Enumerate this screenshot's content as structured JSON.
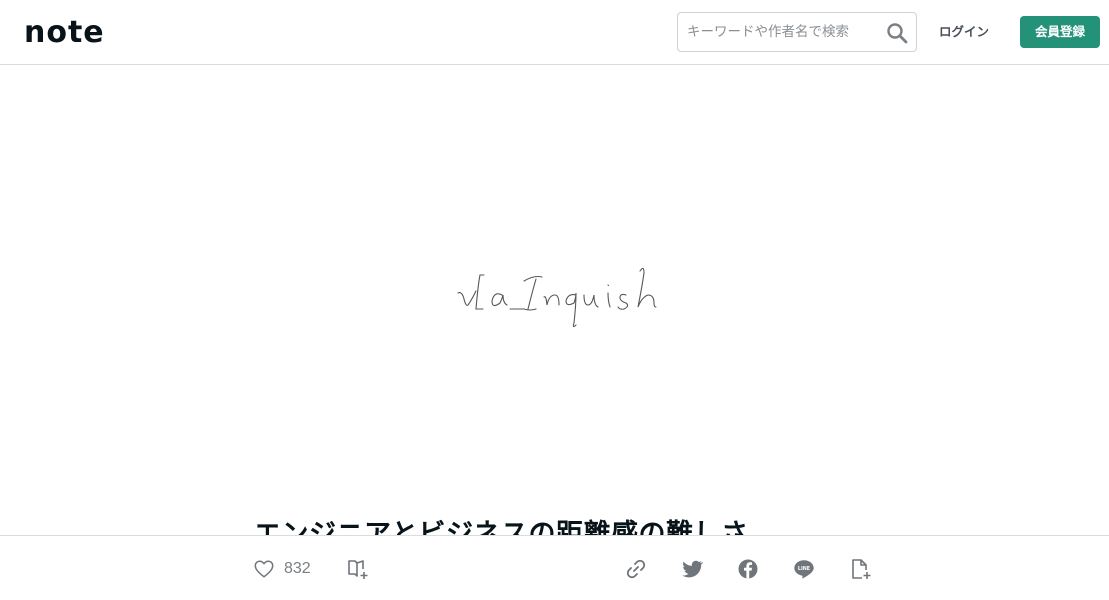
{
  "header": {
    "logo_text": "note",
    "search": {
      "placeholder": "キーワードや作者名で検索",
      "value": ""
    },
    "login_label": "ログイン",
    "signup_label": "会員登録",
    "colors": {
      "signup_bg": "#249279",
      "text": "#08131a"
    }
  },
  "eyecatch": {
    "handwriting_text": "vLaInquish"
  },
  "article": {
    "title": "エンジニアとビジネスの距離感の難しさ"
  },
  "action_bar": {
    "like_count": "832",
    "icons": [
      "heart-icon",
      "magazine-add-icon",
      "link-icon",
      "twitter-icon",
      "facebook-icon",
      "line-icon",
      "note-add-icon"
    ]
  }
}
